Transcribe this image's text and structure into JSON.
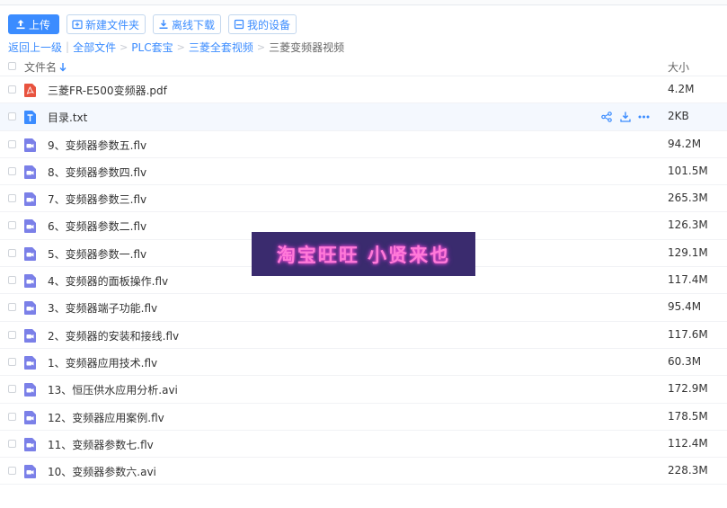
{
  "toolbar": {
    "upload_label": "上传",
    "new_folder_label": "新建文件夹",
    "offline_download_label": "离线下载",
    "my_devices_label": "我的设备"
  },
  "breadcrumb": {
    "back_label": "返回上一级",
    "items": [
      "全部文件",
      "PLC套宝",
      "三菱全套视频"
    ],
    "current": "三菱变频器视频"
  },
  "columns": {
    "name": "文件名",
    "size": "大小"
  },
  "files": [
    {
      "name": "三菱FR-E500变频器.pdf",
      "size": "4.2M",
      "icon": "pdf-icon"
    },
    {
      "name": "目录.txt",
      "size": "2KB",
      "icon": "txt-icon"
    },
    {
      "name": "9、变频器参数五.flv",
      "size": "94.2M",
      "icon": "video-icon"
    },
    {
      "name": "8、变频器参数四.flv",
      "size": "101.5M",
      "icon": "video-icon"
    },
    {
      "name": "7、变频器参数三.flv",
      "size": "265.3M",
      "icon": "video-icon"
    },
    {
      "name": "6、变频器参数二.flv",
      "size": "126.3M",
      "icon": "video-icon"
    },
    {
      "name": "5、变频器参数一.flv",
      "size": "129.1M",
      "icon": "video-icon"
    },
    {
      "name": "4、变频器的面板操作.flv",
      "size": "117.4M",
      "icon": "video-icon"
    },
    {
      "name": "3、变频器端子功能.flv",
      "size": "95.4M",
      "icon": "video-icon"
    },
    {
      "name": "2、变频器的安装和接线.flv",
      "size": "117.6M",
      "icon": "video-icon"
    },
    {
      "name": "1、变频器应用技术.flv",
      "size": "60.3M",
      "icon": "video-icon"
    },
    {
      "name": "13、恒压供水应用分析.avi",
      "size": "172.9M",
      "icon": "video-icon"
    },
    {
      "name": "12、变频器应用案例.flv",
      "size": "178.5M",
      "icon": "video-icon"
    },
    {
      "name": "11、变频器参数七.flv",
      "size": "112.4M",
      "icon": "video-icon"
    },
    {
      "name": "10、变频器参数六.avi",
      "size": "228.3M",
      "icon": "video-icon"
    }
  ],
  "watermark": "淘宝旺旺 小贤来也",
  "colors": {
    "accent": "#3b8cff",
    "pdf": "#e8533f",
    "txt": "#3b8cff",
    "video": "#7b80e8",
    "watermark_bg": "#3a2b6e",
    "watermark_text": "#ff7ad9"
  }
}
